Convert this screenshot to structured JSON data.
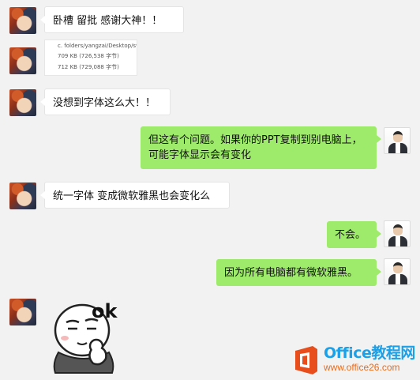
{
  "messages": [
    {
      "from": "other",
      "text": "卧槽 留批 感谢大神！！"
    },
    {
      "from": "other",
      "type": "image",
      "lines": [
        "c. folders/yangzai/Desktop/swiss",
        "709 KB (726,538 字节)",
        "712 KB (729,088 字节)"
      ]
    },
    {
      "from": "other",
      "text": "没想到字体这么大！！"
    },
    {
      "from": "self",
      "text": "但这有个问题。如果你的PPT复制到别电脑上，可能字体显示会有变化"
    },
    {
      "from": "other",
      "text": "统一字体 变成微软雅黑也会变化么"
    },
    {
      "from": "self",
      "text": "不会。"
    },
    {
      "from": "self",
      "text": "因为所有电脑都有微软雅黑。"
    },
    {
      "from": "other",
      "type": "sticker",
      "text": "ok"
    }
  ],
  "watermark": {
    "title": "Office教程网",
    "url": "www.office26.com"
  },
  "colors": {
    "self_bubble": "#9eea6a",
    "other_bubble": "#ffffff",
    "background": "#f2f2f2"
  }
}
